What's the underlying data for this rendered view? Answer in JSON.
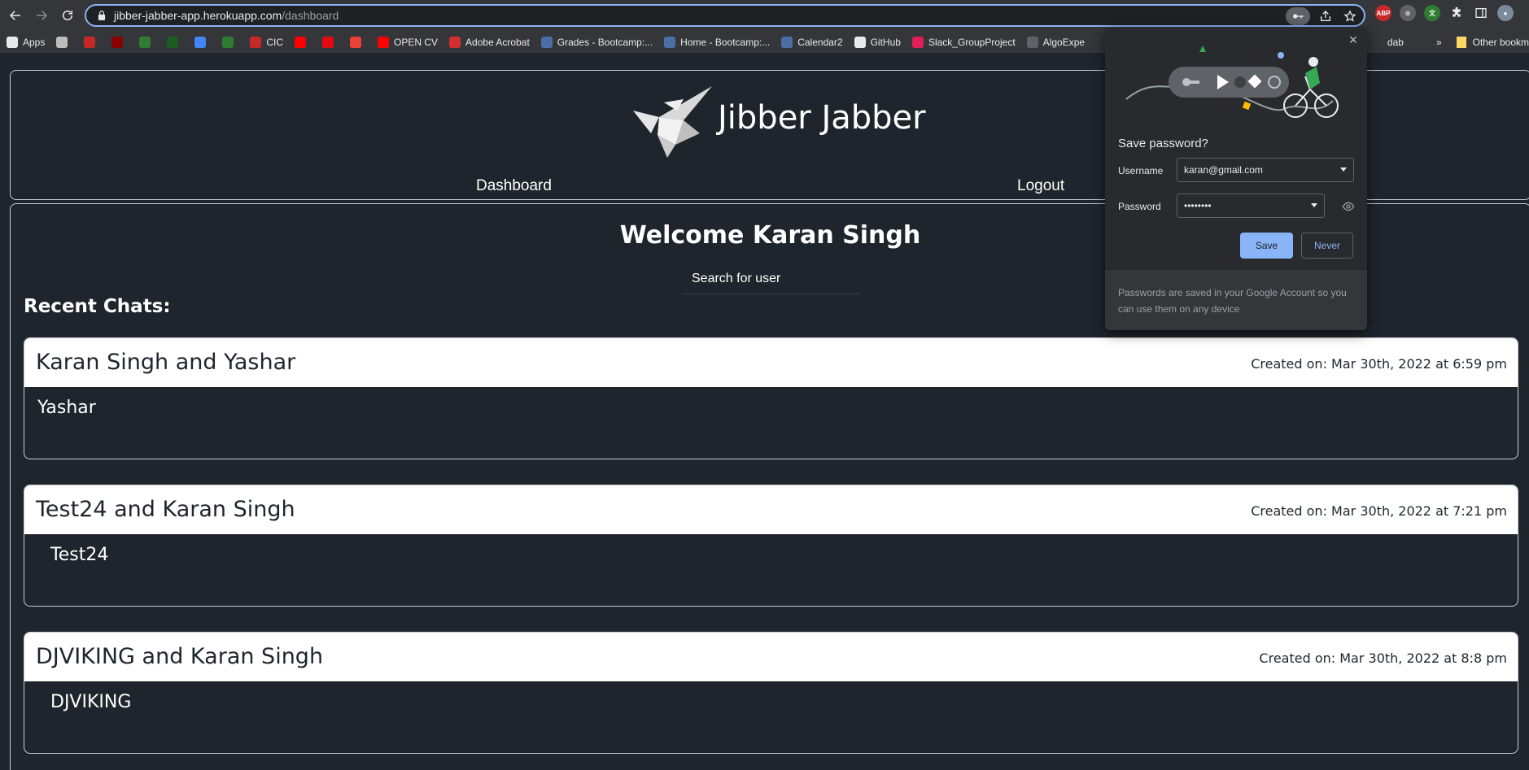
{
  "browser": {
    "url_host": "jibber-jabber-app.herokuapp.com",
    "url_path": "/dashboard",
    "extensions": [
      "ABP"
    ],
    "bookmarks": [
      {
        "label": "Apps",
        "color": "#e8eaed"
      },
      {
        "label": "",
        "color": "#bdbdbd"
      },
      {
        "label": "",
        "color": "#c62828"
      },
      {
        "label": "",
        "color": "#8b0000"
      },
      {
        "label": "",
        "color": "#2e7d32"
      },
      {
        "label": "",
        "color": "#1b5e20"
      },
      {
        "label": "",
        "color": "#4285f4"
      },
      {
        "label": "",
        "color": "#2e7d32"
      },
      {
        "label": "CIC",
        "color": "#c62828"
      },
      {
        "label": "",
        "color": "#ff0000"
      },
      {
        "label": "",
        "color": "#e50914"
      },
      {
        "label": "",
        "color": "#ea4335"
      },
      {
        "label": "OPEN CV",
        "color": "#ff0000"
      },
      {
        "label": "Adobe Acrobat",
        "color": "#d32f2f"
      },
      {
        "label": "Grades - Bootcamp:...",
        "color": "#4a6fa5"
      },
      {
        "label": "Home - Bootcamp:...",
        "color": "#4a6fa5"
      },
      {
        "label": "Calendar2",
        "color": "#4a6fa5"
      },
      {
        "label": "GitHub",
        "color": "#e8eaed"
      },
      {
        "label": "Slack_GroupProject",
        "color": "#e01e5a"
      },
      {
        "label": "AlgoExpe",
        "color": "#5f6368"
      }
    ],
    "bookmarks_tail": "dab",
    "other_bookmarks": "Other bookm"
  },
  "app": {
    "brand": "Jibber Jabber",
    "nav": {
      "dashboard": "Dashboard",
      "logout": "Logout"
    },
    "welcome": "Welcome Karan Singh",
    "search_placeholder": "Search for user",
    "recent_heading": "Recent Chats:",
    "chats": [
      {
        "title": "Karan Singh and Yashar",
        "created": "Created on: Mar 30th, 2022 at 6:59 pm",
        "participant": "Yashar"
      },
      {
        "title": "Test24 and Karan Singh",
        "created": "Created on: Mar 30th, 2022 at 7:21 pm",
        "participant": "Test24"
      },
      {
        "title": "DJVIKING and Karan Singh",
        "created": "Created on: Mar 30th, 2022 at 8:8 pm",
        "participant": "DJVIKING"
      }
    ]
  },
  "password_popup": {
    "title": "Save password?",
    "username_label": "Username",
    "username_value": "karan@gmail.com",
    "password_label": "Password",
    "password_value": "••••••••",
    "save_label": "Save",
    "never_label": "Never",
    "footer": "Passwords are saved in your Google Account so you can use them on any device"
  }
}
